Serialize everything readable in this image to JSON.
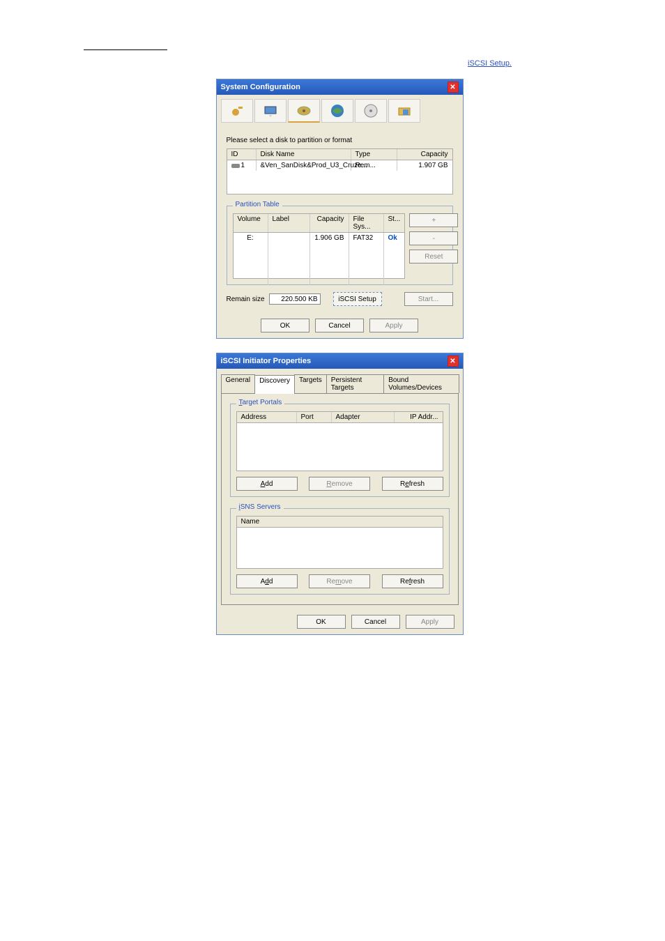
{
  "header": {
    "link_text": "iSCSI Setup."
  },
  "dialog1": {
    "title": "System Configuration",
    "instruction": "Please select a disk to partition or format",
    "disk_table": {
      "headers": [
        "ID",
        "Disk Name",
        "Type",
        "Capacity"
      ],
      "row": {
        "id": "1",
        "name": "&Ven_SanDisk&Prod_U3_Cruze...",
        "type": "Rem...",
        "capacity": "1.907 GB"
      }
    },
    "partition": {
      "legend": "Partition Table",
      "headers": [
        "Volume",
        "Label",
        "Capacity",
        "File Sys...",
        "St..."
      ],
      "row": {
        "vol": "E:",
        "label": "",
        "capacity": "1.906 GB",
        "fs": "FAT32",
        "status": "Ok"
      },
      "side_buttons": {
        "plus": "+",
        "minus": "-",
        "reset": "Reset"
      }
    },
    "remain": {
      "label": "Remain size",
      "value": "220.500 KB"
    },
    "iscsi_btn": "iSCSI Setup",
    "start_btn": "Start...",
    "ok": "OK",
    "cancel": "Cancel",
    "apply": "Apply"
  },
  "dialog2": {
    "title": "iSCSI Initiator Properties",
    "tabs": [
      "General",
      "Discovery",
      "Targets",
      "Persistent Targets",
      "Bound Volumes/Devices"
    ],
    "active_tab": "Discovery",
    "portals": {
      "legend": "Target Portals",
      "headers": [
        "Address",
        "Port",
        "Adapter",
        "IP Addr..."
      ]
    },
    "isns": {
      "legend": "iSNS Servers",
      "header": "Name"
    },
    "add": "Add",
    "remove": "Remove",
    "refresh": "Refresh",
    "ok": "OK",
    "cancel": "Cancel",
    "apply": "Apply"
  }
}
